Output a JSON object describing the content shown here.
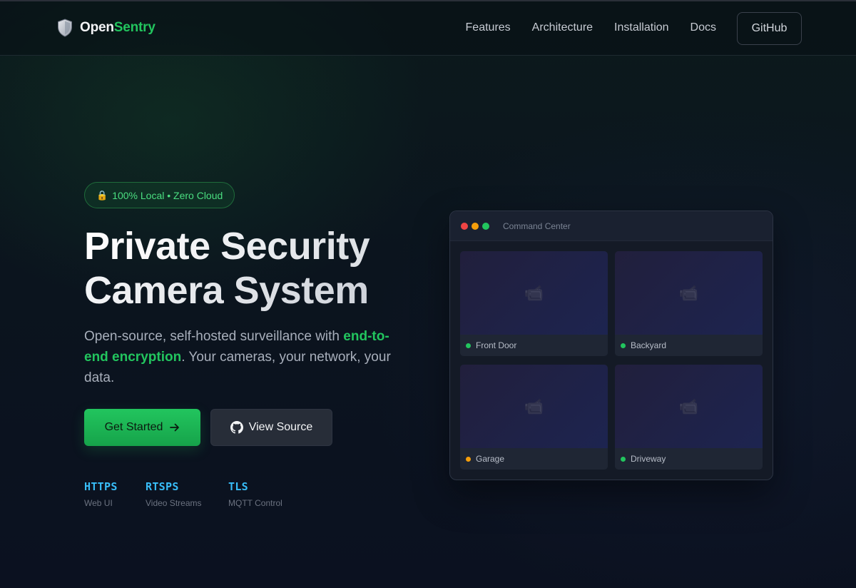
{
  "brand": {
    "name_part1": "Open",
    "name_part2": "Sentry",
    "logo_icon": "shield-icon"
  },
  "nav": {
    "links": [
      "Features",
      "Architecture",
      "Installation",
      "Docs"
    ],
    "github_label": "GitHub"
  },
  "hero": {
    "badge": {
      "icon": "🔒",
      "text": "100% Local • Zero Cloud"
    },
    "title_line1": "Private Security",
    "title_line2": "Camera System",
    "desc_before": "Open-source, self-hosted surveillance with ",
    "desc_highlight": "end-to-end encryption",
    "desc_after": ". Your cameras, your network, your data.",
    "primary_button": "Get Started",
    "secondary_button": "View Source",
    "protocols": [
      {
        "name": "HTTPS",
        "desc": "Web UI"
      },
      {
        "name": "RTSPS",
        "desc": "Video Streams"
      },
      {
        "name": "TLS",
        "desc": "MQTT Control"
      }
    ]
  },
  "command_center": {
    "title": "Command Center",
    "window_dots": [
      "#ef4444",
      "#f59e0b",
      "#22c55e"
    ],
    "cameras": [
      {
        "label": "Front Door",
        "status": "online",
        "status_color": "#22c55e"
      },
      {
        "label": "Backyard",
        "status": "online",
        "status_color": "#22c55e"
      },
      {
        "label": "Garage",
        "status": "warning",
        "status_color": "#f59e0b"
      },
      {
        "label": "Driveway",
        "status": "online",
        "status_color": "#22c55e"
      }
    ],
    "camera_icon": "video-camera-icon"
  },
  "colors": {
    "accent": "#22c55e",
    "protocol": "#38bdf8",
    "background": "#0b1120"
  }
}
